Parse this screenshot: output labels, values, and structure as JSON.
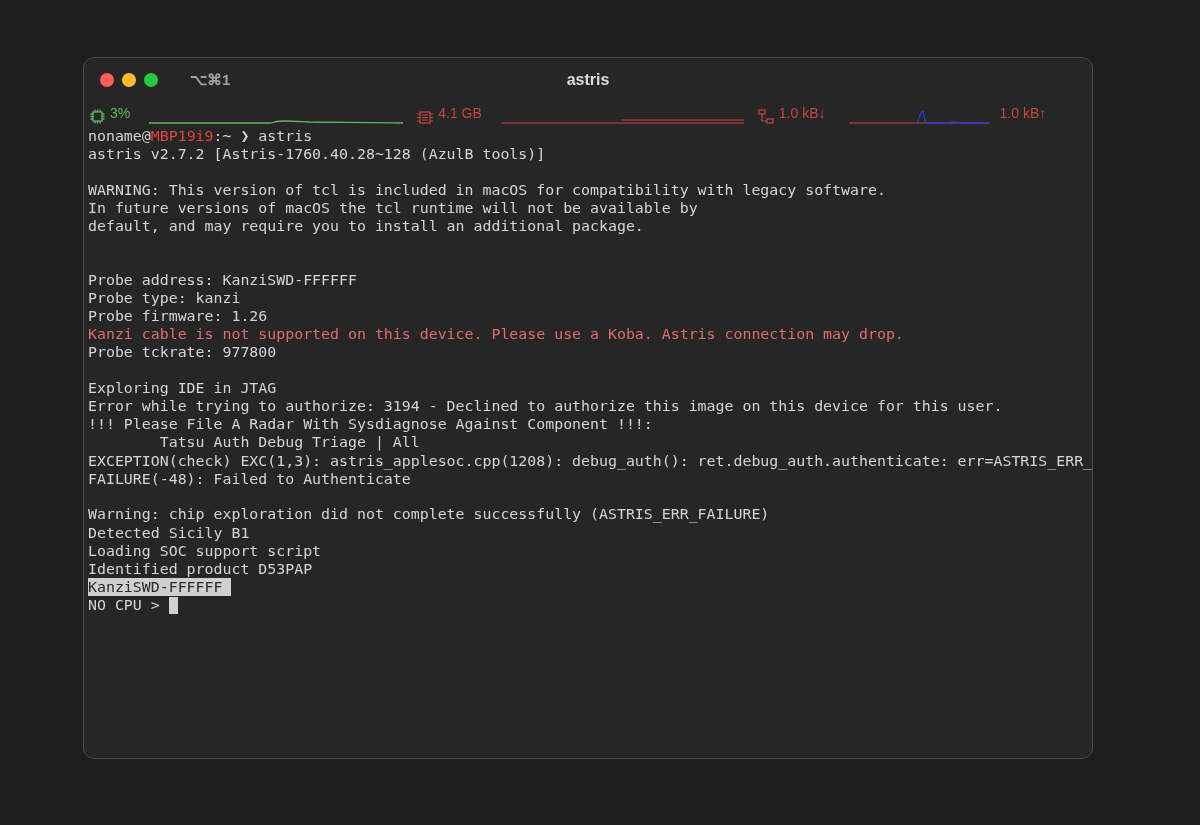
{
  "window": {
    "title": "astris",
    "shortcut": "⌥⌘1"
  },
  "status_bar": [
    {
      "kind": "cpu",
      "reading": "3%",
      "color": "#5cb85c"
    },
    {
      "kind": "memory",
      "reading": "4.1 GB",
      "color": "#c9453d"
    },
    {
      "kind": "network",
      "reading": "1.0 kB↓",
      "color": "#c9453d"
    },
    {
      "kind": "upload",
      "reading": "1.0 kB↑",
      "color": "#c9453d"
    }
  ],
  "terminal": {
    "lines": [
      {
        "kind": "prompt",
        "user": "noname@",
        "host": "MBP19i9",
        "command": ":~ ❯ astris"
      },
      {
        "kind": "normal",
        "text": "astris v2.7.2 [Astris-1760.40.28~128 (AzulB tools)]"
      },
      {
        "kind": "blank"
      },
      {
        "kind": "normal",
        "text": "WARNING: This version of tcl is included in macOS for compatibility with legacy software."
      },
      {
        "kind": "normal",
        "text": "In future versions of macOS the tcl runtime will not be available by"
      },
      {
        "kind": "normal",
        "text": "default, and may require you to install an additional package."
      },
      {
        "kind": "blank"
      },
      {
        "kind": "blank"
      },
      {
        "kind": "normal",
        "text": "Probe address: KanziSWD-FFFFFF"
      },
      {
        "kind": "normal",
        "text": "Probe type: kanzi"
      },
      {
        "kind": "normal",
        "text": "Probe firmware: 1.26"
      },
      {
        "kind": "error",
        "text": "Kanzi cable is not supported on this device. Please use a Koba. Astris connection may drop."
      },
      {
        "kind": "normal",
        "text": "Probe tckrate: 977800"
      },
      {
        "kind": "blank"
      },
      {
        "kind": "normal",
        "text": "Exploring IDE in JTAG"
      },
      {
        "kind": "normal",
        "text": "Error while trying to authorize: 3194 - Declined to authorize this image on this device for this user."
      },
      {
        "kind": "normal",
        "text": "!!! Please File A Radar With Sysdiagnose Against Component !!!:"
      },
      {
        "kind": "normal",
        "text": "        Tatsu Auth Debug Triage | All"
      },
      {
        "kind": "normal",
        "text": "EXCEPTION(check) EXC(1,3): astris_applesoc.cpp(1208): debug_auth(): ret.debug_auth.authenticate: err=ASTRIS_ERR_"
      },
      {
        "kind": "normal",
        "text": "FAILURE(-48): Failed to Authenticate"
      },
      {
        "kind": "blank"
      },
      {
        "kind": "normal",
        "text": "Warning: chip exploration did not complete successfully (ASTRIS_ERR_FAILURE)"
      },
      {
        "kind": "normal",
        "text": "Detected Sicily B1"
      },
      {
        "kind": "normal",
        "text": "Loading SOC support script"
      },
      {
        "kind": "normal",
        "text": "Identified product D53PAP"
      },
      {
        "kind": "highlight",
        "text": "KanziSWD-FFFFFF "
      },
      {
        "kind": "input",
        "text": "NO CPU > "
      }
    ]
  }
}
